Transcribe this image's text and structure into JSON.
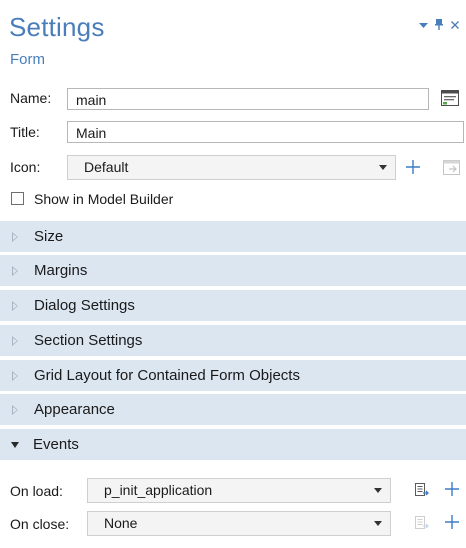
{
  "header": {
    "title": "Settings",
    "subtitle": "Form",
    "controls": [
      "chevron-down-icon",
      "pin-icon",
      "close-icon"
    ]
  },
  "fields": {
    "name_label": "Name:",
    "name_value": "main",
    "title_label": "Title:",
    "title_value": "Main",
    "icon_label": "Icon:",
    "icon_value": "Default"
  },
  "checkbox": {
    "label": "Show in Model Builder",
    "checked": false
  },
  "sections": [
    {
      "label": "Size",
      "expanded": false
    },
    {
      "label": "Margins",
      "expanded": false
    },
    {
      "label": "Dialog Settings",
      "expanded": false
    },
    {
      "label": "Section Settings",
      "expanded": false
    },
    {
      "label": "Grid Layout for Contained Form Objects",
      "expanded": false
    },
    {
      "label": "Appearance",
      "expanded": false
    },
    {
      "label": "Events",
      "expanded": true
    }
  ],
  "events": {
    "on_load_label": "On load:",
    "on_load_value": "p_init_application",
    "on_close_label": "On close:",
    "on_close_value": "None"
  },
  "colors": {
    "accent": "#4a7ebb",
    "section_bg": "#dce6f1",
    "plus_icon": "#3d7cc9"
  }
}
